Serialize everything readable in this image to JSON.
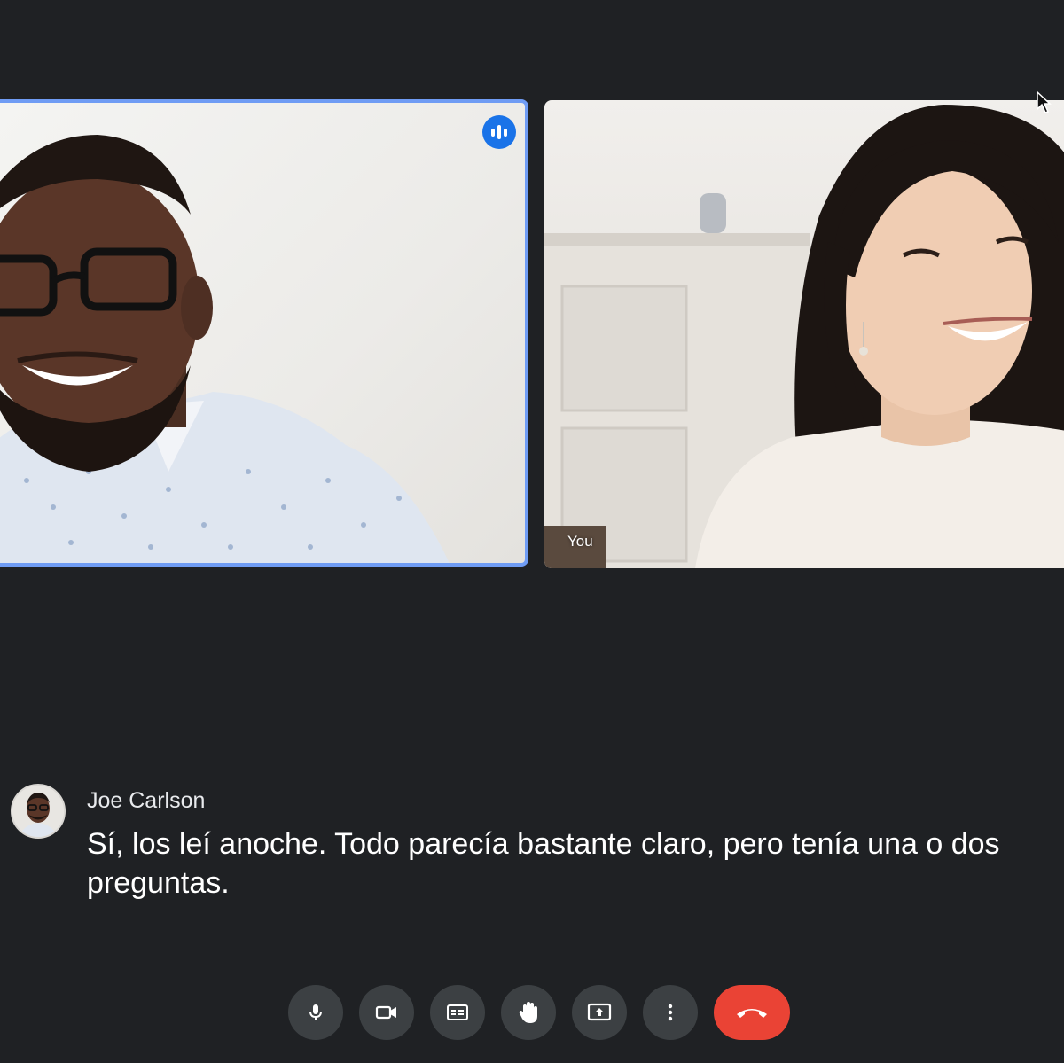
{
  "participants": [
    {
      "id": "joe",
      "label": "",
      "speaking": true
    },
    {
      "id": "you",
      "label": "You",
      "speaking": false
    }
  ],
  "caption": {
    "speaker": "Joe Carlson",
    "text": "Sí, los leí anoche. Todo parecía bastante claro, pero tenía una o dos preguntas."
  },
  "controls": [
    {
      "icon": "microphone-icon",
      "label": "Microphone"
    },
    {
      "icon": "camera-icon",
      "label": "Camera"
    },
    {
      "icon": "closed-captions-icon",
      "label": "Captions"
    },
    {
      "icon": "raise-hand-icon",
      "label": "Raise hand"
    },
    {
      "icon": "present-screen-icon",
      "label": "Present"
    },
    {
      "icon": "more-options-icon",
      "label": "More options"
    },
    {
      "icon": "end-call-icon",
      "label": "Leave call"
    }
  ],
  "colors": {
    "background": "#1f2124",
    "active_speaker_border": "#6f9cf4",
    "speaking_badge": "#1a73e8",
    "control_button": "#3c4043",
    "end_call": "#ea4335"
  }
}
